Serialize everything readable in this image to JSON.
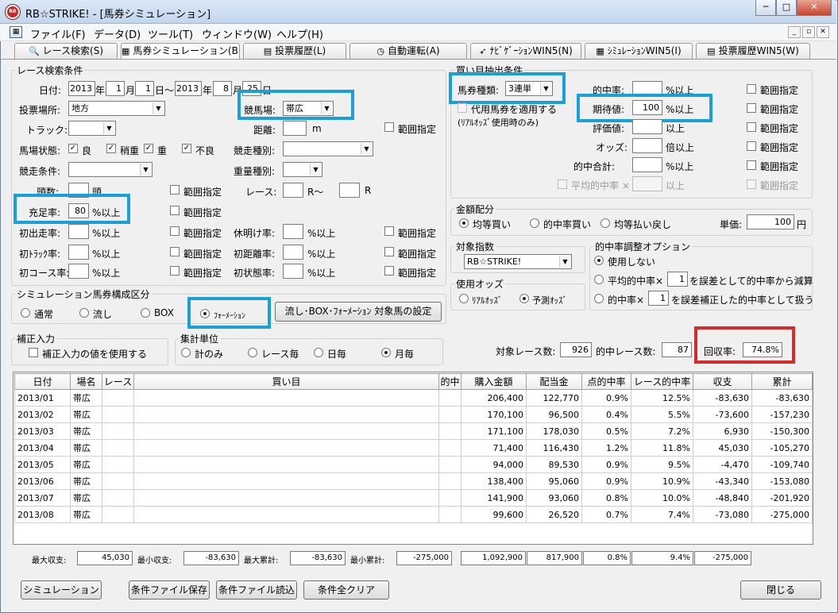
{
  "window": {
    "title": "RB☆STRIKE! - [馬券シミュレーション]",
    "controls": [
      "─",
      "□",
      "✕"
    ]
  },
  "menu": {
    "items": [
      "ファイル(F)",
      "データ(D)",
      "ツール(T)",
      "ウィンドウ(W)",
      "ヘルプ(H)"
    ],
    "mdi": [
      "_",
      "▫",
      "✕"
    ]
  },
  "tabs": [
    {
      "label": "レース検索(S)",
      "icon": "magnifier-icon",
      "glyph": "🔍"
    },
    {
      "label": "馬券シミュレーション(B)",
      "icon": "grid-icon",
      "glyph": "▦"
    },
    {
      "label": "投票履歴(L)",
      "icon": "document-icon",
      "glyph": "▤"
    },
    {
      "label": "自動運転(A)",
      "icon": "clock-icon",
      "glyph": "◷"
    },
    {
      "label": "ﾅﾋﾞｹﾞｰｼｮﾝWIN5(N)",
      "icon": "navigation-icon",
      "glyph": "➶"
    },
    {
      "label": "ｼﾐｭﾚｰｼｮﾝWIN5(I)",
      "icon": "grid-icon",
      "glyph": "▦"
    },
    {
      "label": "投票履歴WIN5(W)",
      "icon": "document-icon",
      "glyph": "▤"
    }
  ],
  "race_search": {
    "legend": "レース検索条件",
    "date_label": "日付:",
    "from_year": "2013",
    "year_char": "年",
    "from_month": "1",
    "month_char": "月",
    "from_day": "1",
    "day_range": "日〜",
    "to_year": "2013",
    "to_month": "8",
    "to_day": "25",
    "day_char": "日",
    "venue_label": "投票場所:",
    "venue_value": "地方",
    "course_label": "競馬場:",
    "course_value": "帯広",
    "track_label": "トラック:",
    "distance_label": "距離:",
    "distance_unit": "m",
    "range_label": "範囲指定",
    "condition_label": "馬場状態:",
    "conditions": [
      "良",
      "稍重",
      "重",
      "不良"
    ],
    "race_type_label": "競走種別:",
    "race_cond_label": "競走条件:",
    "weight_type_label": "重量種別:",
    "heads_label": "頭数:",
    "heads_unit": "頭",
    "race_label": "レース:",
    "race_r1": "R〜",
    "race_r2": "R",
    "fill_label": "充足率:",
    "fill_value": "80",
    "pct_over": "%以上",
    "debut_label": "初出走率:",
    "rest_label": "休明け率:",
    "first_track_label": "初ﾄﾗｯｸ率:",
    "first_dist_label": "初距離率:",
    "first_course_label": "初コース率:",
    "first_state_label": "初状態率:"
  },
  "bet_type": {
    "legend": "シミュレーション馬券構成区分",
    "options": [
      "通常",
      "流し",
      "BOX",
      "ﾌｫｰﾒｰｼｮﾝ"
    ],
    "selected": "ﾌｫｰﾒｰｼｮﾝ",
    "setting_button": "流し･BOX･ﾌｫｰﾒｰｼｮﾝ 対象馬の設定"
  },
  "correction": {
    "legend": "補正入力",
    "checkbox": "補正入力の値を使用する"
  },
  "aggregate": {
    "legend": "集計単位",
    "options": [
      "計のみ",
      "レース毎",
      "日毎",
      "月毎"
    ],
    "selected": "月毎"
  },
  "extract": {
    "legend": "買い目抽出条件",
    "ticket_label": "馬券種類:",
    "ticket_value": "3連単",
    "odds_check": "代用馬券を適用する",
    "odds_note": "(ﾘｱﾙｵｯｽﾞ使用時のみ)",
    "hit_rate_label": "的中率:",
    "expect_label": "期待値:",
    "expect_value": "100",
    "eval_label": "評価値:",
    "odds_label": "オッズ:",
    "hit_total_label": "的中合計:",
    "avg_hit_label": "平均的中率 ×",
    "pct_over": "%以上",
    "over": "以上",
    "times_over": "倍以上",
    "range_label": "範囲指定"
  },
  "amount": {
    "legend": "金額配分",
    "options": [
      "均等買い",
      "的中率買い",
      "均等払い戻し"
    ],
    "selected": "均等買い",
    "unit_label": "単価:",
    "unit_value": "100",
    "yen": "円"
  },
  "index": {
    "legend": "対象指数",
    "value": "RB☆STRIKE!"
  },
  "odds_use": {
    "legend": "使用オッズ",
    "options": [
      "ﾘｱﾙｵｯｽﾞ",
      "予測ｵｯｽﾞ"
    ],
    "selected": "予測ｵｯｽﾞ"
  },
  "adjust": {
    "legend": "的中率調整オプション",
    "opt1": "使用しない",
    "opt2_pre": "平均的中率×",
    "opt2_val": "1",
    "opt2_post": "を誤差として的中率から減算",
    "opt3_pre": "的中率×",
    "opt3_val": "1",
    "opt3_post": "を誤差補正した的中率として扱う",
    "selected": "使用しない"
  },
  "stats": {
    "races_label": "対象レース数:",
    "races": "926",
    "hits_label": "的中レース数:",
    "hits": "87",
    "return_label": "回収率:",
    "return_rate": "74.8%"
  },
  "table": {
    "headers": [
      "日付",
      "場名",
      "レース",
      "買い目",
      "的中",
      "購入金額",
      "配当金",
      "点的中率",
      "レース的中率",
      "収支",
      "累計"
    ],
    "rows": [
      [
        "2013/01",
        "帯広",
        "",
        "",
        "",
        "206,400",
        "122,770",
        "0.9%",
        "12.5%",
        "-83,630",
        "-83,630"
      ],
      [
        "2013/02",
        "帯広",
        "",
        "",
        "",
        "170,100",
        "96,500",
        "0.4%",
        "5.5%",
        "-73,600",
        "-157,230"
      ],
      [
        "2013/03",
        "帯広",
        "",
        "",
        "",
        "171,100",
        "178,030",
        "0.5%",
        "7.2%",
        "6,930",
        "-150,300"
      ],
      [
        "2013/04",
        "帯広",
        "",
        "",
        "",
        "71,400",
        "116,430",
        "1.2%",
        "11.8%",
        "45,030",
        "-105,270"
      ],
      [
        "2013/05",
        "帯広",
        "",
        "",
        "",
        "94,000",
        "89,530",
        "0.9%",
        "9.5%",
        "-4,470",
        "-109,740"
      ],
      [
        "2013/06",
        "帯広",
        "",
        "",
        "",
        "138,400",
        "95,060",
        "0.9%",
        "10.9%",
        "-43,340",
        "-153,080"
      ],
      [
        "2013/07",
        "帯広",
        "",
        "",
        "",
        "141,900",
        "93,060",
        "0.8%",
        "10.0%",
        "-48,840",
        "-201,920"
      ],
      [
        "2013/08",
        "帯広",
        "",
        "",
        "",
        "99,600",
        "26,520",
        "0.7%",
        "7.4%",
        "-73,080",
        "-275,000"
      ]
    ]
  },
  "summary": {
    "max_balance_label": "最大収支:",
    "max_balance": "45,030",
    "min_balance_label": "最小収支:",
    "min_balance": "-83,630",
    "max_cum_label": "最大累計:",
    "max_cum": "-83,630",
    "min_cum_label": "最小累計:",
    "min_cum": "-275,000",
    "total_buy": "1,092,900",
    "total_pay": "817,900",
    "point_hit": "0.8%",
    "race_hit": "9.4%",
    "total_balance": "-275,000"
  },
  "footer": {
    "simulate": "シミュレーション",
    "save": "条件ファイル保存",
    "load": "条件ファイル読込",
    "clear": "条件全クリア",
    "close": "閉じる"
  }
}
